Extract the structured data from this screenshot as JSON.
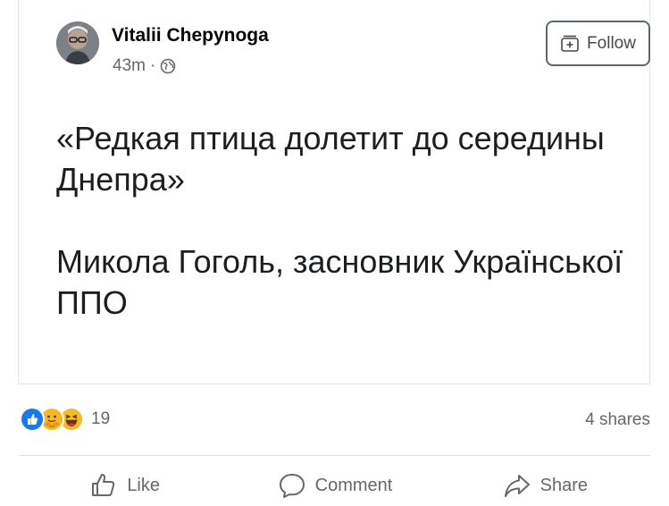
{
  "post": {
    "author": "Vitalii Chepynoga",
    "time": "43m",
    "separator": "·",
    "privacy_icon": "globe-icon",
    "follow_label": "Follow",
    "text_paragraphs": [
      "«Редкая птица долетит до середины Днепра»",
      "Микола Гоголь, засновник Української ППО"
    ]
  },
  "stats": {
    "reaction_icons": [
      "like-icon",
      "care-icon",
      "haha-icon"
    ],
    "reaction_count": "19",
    "shares": "4 shares"
  },
  "actions": {
    "like_label": "Like",
    "comment_label": "Comment",
    "share_label": "Share"
  },
  "colors": {
    "like_blue": "#1877f2",
    "reaction_yellow": "#f7b928",
    "text_secondary": "#65676b",
    "text_primary": "#1c1e21"
  }
}
